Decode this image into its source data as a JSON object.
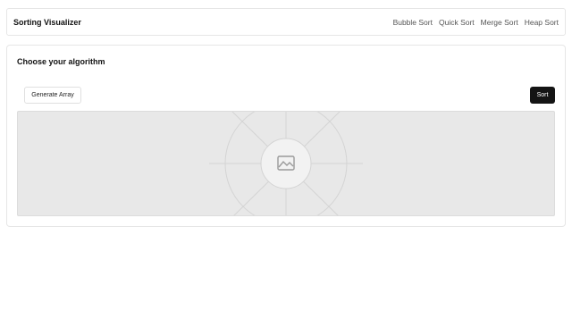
{
  "navbar": {
    "brand": "Sorting Visualizer",
    "links": [
      "Bubble Sort",
      "Quick Sort",
      "Merge Sort",
      "Heap Sort"
    ]
  },
  "card": {
    "title": "Choose your algorithm",
    "generate_label": "Generate Array",
    "sort_label": "Sort"
  },
  "visualization": {
    "placeholder_icon": "image-placeholder-icon"
  },
  "colors": {
    "sort_button_bg": "#141414",
    "canvas_bg": "#e8e8e8"
  }
}
